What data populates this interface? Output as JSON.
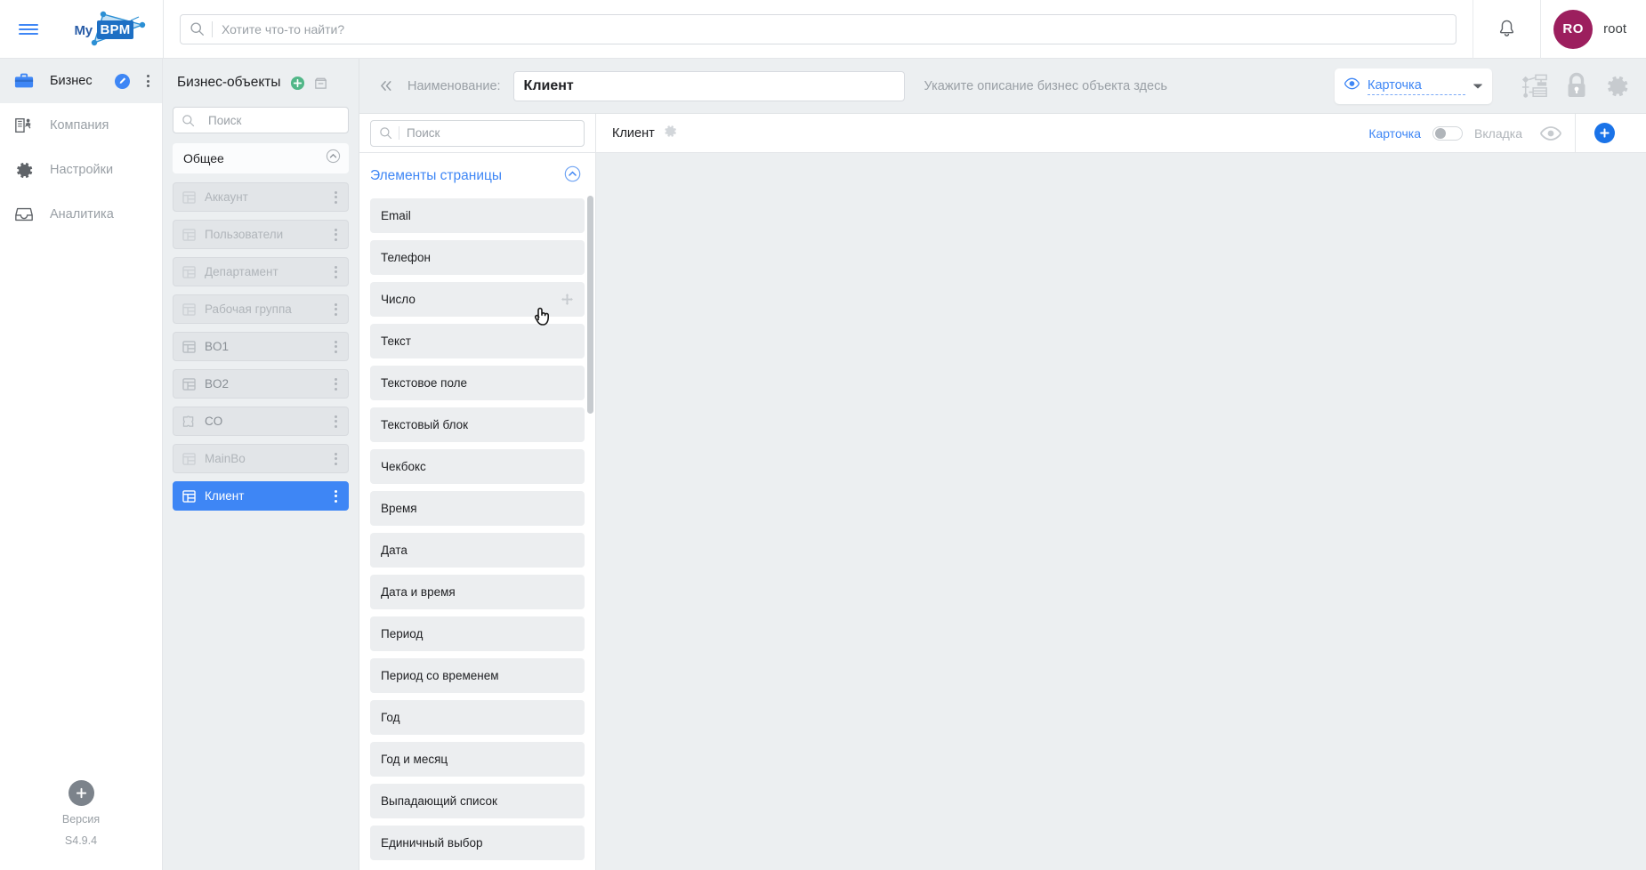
{
  "topbar": {
    "menu_icon": "hamburger-menu-icon",
    "logo": {
      "prefix": "My",
      "badge": "BPM"
    },
    "search": {
      "placeholder": "Хотите что-то найти?",
      "value": "",
      "icon": "search-icon"
    },
    "notifications_icon": "bell-icon",
    "user": {
      "initials": "RO",
      "name": "root"
    }
  },
  "leftnav": {
    "items": [
      {
        "label": "Бизнес",
        "icon": "briefcase-icon",
        "active": true
      },
      {
        "label": "Компания",
        "icon": "company-building-icon",
        "active": false
      },
      {
        "label": "Настройки",
        "icon": "gear-icon",
        "active": false
      },
      {
        "label": "Аналитика",
        "icon": "analytics-tray-icon",
        "active": false
      }
    ],
    "footer": {
      "add_icon": "plus-circle-icon",
      "version_label": "Версия",
      "version_number": "S4.9.4"
    }
  },
  "objects_panel": {
    "title": "Бизнес-объекты",
    "add_icon": "add-circle-green-icon",
    "archive_icon": "archive-box-icon",
    "search": {
      "placeholder": "Поиск",
      "value": "",
      "icon": "search-icon"
    },
    "group": {
      "label": "Общее",
      "collapse_icon": "chevron-up-circle-icon"
    },
    "items": [
      {
        "label": "Аккаунт",
        "icon": "table-object-icon",
        "state": "dim"
      },
      {
        "label": "Пользователи",
        "icon": "table-object-icon",
        "state": "dim"
      },
      {
        "label": "Департамент",
        "icon": "table-object-icon",
        "state": "dim"
      },
      {
        "label": "Рабочая группа",
        "icon": "table-object-icon",
        "state": "dim"
      },
      {
        "label": "BO1",
        "icon": "table-object-icon",
        "state": "mid"
      },
      {
        "label": "BO2",
        "icon": "table-object-icon",
        "state": "mid"
      },
      {
        "label": "CO",
        "icon": "puzzle-object-icon",
        "state": "mid"
      },
      {
        "label": "MainBo",
        "icon": "table-object-icon",
        "state": "dim"
      },
      {
        "label": "Клиент",
        "icon": "table-object-icon",
        "state": "selected"
      }
    ]
  },
  "main_toolbar": {
    "collapse_icon": "double-chevron-left-icon",
    "name_label": "Наименование:",
    "name_value": "Клиент",
    "description_placeholder": "Укажите описание бизнес объекта здесь",
    "description_value": "",
    "view_select": {
      "icon": "eye-icon",
      "value": "Карточка",
      "caret": "caret-down-icon"
    },
    "icons": [
      {
        "name": "workflow-diagram-icon"
      },
      {
        "name": "lock-icon"
      },
      {
        "name": "gear-icon"
      }
    ]
  },
  "panel_search": {
    "placeholder": "Поиск",
    "value": "",
    "icon": "search-icon"
  },
  "tabstrip": {
    "tab": {
      "label": "Клиент",
      "settings_icon": "gear-icon"
    },
    "toggle": {
      "left_label": "Карточка",
      "right_label": "Вкладка",
      "state": "left"
    },
    "preview_icon": "eye-outline-icon",
    "add_icon": "plus-circle-blue-icon"
  },
  "elements_panel": {
    "header": {
      "title": "Элементы страницы",
      "collapse_icon": "chevron-up-circle-icon"
    },
    "items": [
      {
        "label": "Email"
      },
      {
        "label": "Телефон"
      },
      {
        "label": "Число",
        "hovered": true,
        "drag_icon": "move-arrows-icon"
      },
      {
        "label": "Текст"
      },
      {
        "label": "Текстовое поле"
      },
      {
        "label": "Текстовый блок"
      },
      {
        "label": "Чекбокс"
      },
      {
        "label": "Время"
      },
      {
        "label": "Дата"
      },
      {
        "label": "Дата и время"
      },
      {
        "label": "Период"
      },
      {
        "label": "Период со временем"
      },
      {
        "label": "Год"
      },
      {
        "label": "Год и месяц"
      },
      {
        "label": "Выпадающий список"
      },
      {
        "label": "Единичный выбор"
      }
    ]
  },
  "colors": {
    "accent_blue": "#3e86f5",
    "selected_blue": "#3e86f5",
    "panel_gray": "#eceff1",
    "item_gray": "#e2e5e8",
    "avatar_magenta": "#9c1f5e",
    "green_add": "#52b788"
  }
}
